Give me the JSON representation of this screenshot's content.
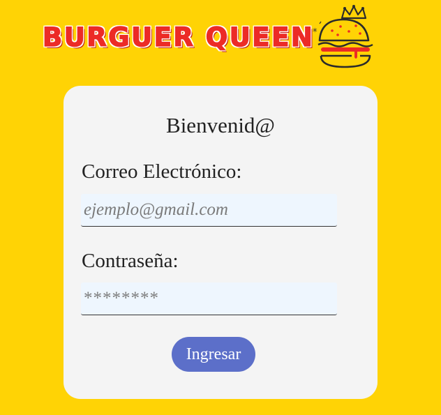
{
  "header": {
    "brand_title": "BURGUER QUEEN",
    "logo_icon": "burger-with-crown-icon"
  },
  "login": {
    "title": "Bienvenid@",
    "email_label": "Correo Electrónico:",
    "email_placeholder": "ejemplo@gmail.com",
    "email_value": "",
    "password_label": "Contraseña:",
    "password_placeholder": "********",
    "password_value": "",
    "submit_label": "Ingresar"
  },
  "colors": {
    "page_background": "#FFD305",
    "card_background": "#F4F4F4",
    "brand_red": "#EC2B26",
    "field_background": "#EEF6FE",
    "button_background": "#5C6FC9"
  }
}
